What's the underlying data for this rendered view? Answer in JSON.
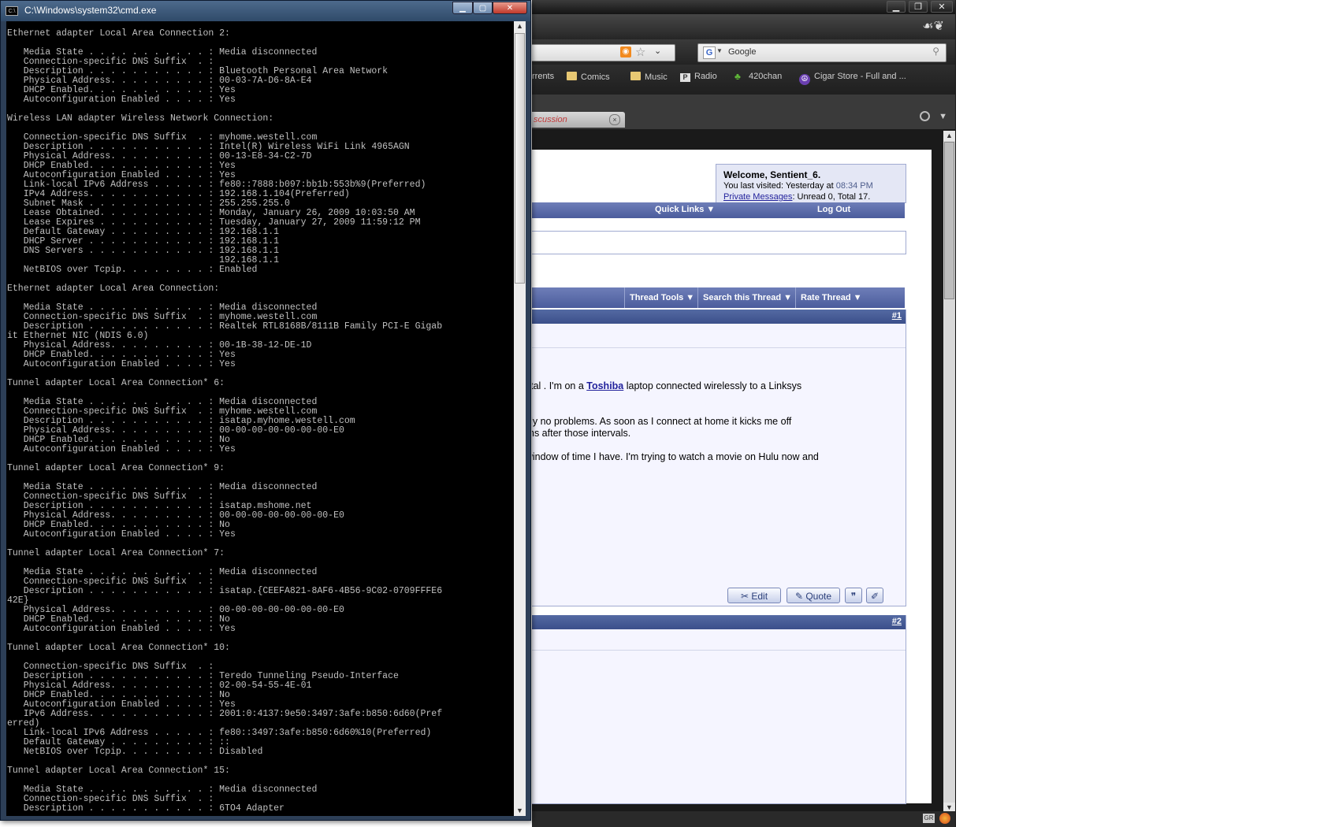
{
  "cmd": {
    "title": "C:\\Windows\\system32\\cmd.exe",
    "icon": "C:\\",
    "controls": {
      "minimize": "▁",
      "maximize": "▢",
      "close": "✕"
    },
    "lines": [
      "Ethernet adapter Local Area Connection 2:",
      "",
      "   Media State . . . . . . . . . . . : Media disconnected",
      "   Connection-specific DNS Suffix  . :",
      "   Description . . . . . . . . . . . : Bluetooth Personal Area Network",
      "   Physical Address. . . . . . . . . : 00-03-7A-D6-8A-E4",
      "   DHCP Enabled. . . . . . . . . . . : Yes",
      "   Autoconfiguration Enabled . . . . : Yes",
      "",
      "Wireless LAN adapter Wireless Network Connection:",
      "",
      "   Connection-specific DNS Suffix  . : myhome.westell.com",
      "   Description . . . . . . . . . . . : Intel(R) Wireless WiFi Link 4965AGN",
      "   Physical Address. . . . . . . . . : 00-13-E8-34-C2-7D",
      "   DHCP Enabled. . . . . . . . . . . : Yes",
      "   Autoconfiguration Enabled . . . . : Yes",
      "   Link-local IPv6 Address . . . . . : fe80::7888:b097:bb1b:553b%9(Preferred)",
      "   IPv4 Address. . . . . . . . . . . : 192.168.1.104(Preferred)",
      "   Subnet Mask . . . . . . . . . . . : 255.255.255.0",
      "   Lease Obtained. . . . . . . . . . : Monday, January 26, 2009 10:03:50 AM",
      "   Lease Expires . . . . . . . . . . : Tuesday, January 27, 2009 11:59:12 PM",
      "   Default Gateway . . . . . . . . . : 192.168.1.1",
      "   DHCP Server . . . . . . . . . . . : 192.168.1.1",
      "   DNS Servers . . . . . . . . . . . : 192.168.1.1",
      "                                       192.168.1.1",
      "   NetBIOS over Tcpip. . . . . . . . : Enabled",
      "",
      "Ethernet adapter Local Area Connection:",
      "",
      "   Media State . . . . . . . . . . . : Media disconnected",
      "   Connection-specific DNS Suffix  . : myhome.westell.com",
      "   Description . . . . . . . . . . . : Realtek RTL8168B/8111B Family PCI-E Gigab",
      "it Ethernet NIC (NDIS 6.0)",
      "   Physical Address. . . . . . . . . : 00-1B-38-12-DE-1D",
      "   DHCP Enabled. . . . . . . . . . . : Yes",
      "   Autoconfiguration Enabled . . . . : Yes",
      "",
      "Tunnel adapter Local Area Connection* 6:",
      "",
      "   Media State . . . . . . . . . . . : Media disconnected",
      "   Connection-specific DNS Suffix  . : myhome.westell.com",
      "   Description . . . . . . . . . . . : isatap.myhome.westell.com",
      "   Physical Address. . . . . . . . . : 00-00-00-00-00-00-00-E0",
      "   DHCP Enabled. . . . . . . . . . . : No",
      "   Autoconfiguration Enabled . . . . : Yes",
      "",
      "Tunnel adapter Local Area Connection* 9:",
      "",
      "   Media State . . . . . . . . . . . : Media disconnected",
      "   Connection-specific DNS Suffix  . :",
      "   Description . . . . . . . . . . . : isatap.mshome.net",
      "   Physical Address. . . . . . . . . : 00-00-00-00-00-00-00-E0",
      "   DHCP Enabled. . . . . . . . . . . : No",
      "   Autoconfiguration Enabled . . . . : Yes",
      "",
      "Tunnel adapter Local Area Connection* 7:",
      "",
      "   Media State . . . . . . . . . . . : Media disconnected",
      "   Connection-specific DNS Suffix  . :",
      "   Description . . . . . . . . . . . : isatap.{CEEFA821-8AF6-4B56-9C02-0709FFFE6",
      "42E}",
      "   Physical Address. . . . . . . . . : 00-00-00-00-00-00-00-E0",
      "   DHCP Enabled. . . . . . . . . . . : No",
      "   Autoconfiguration Enabled . . . . : Yes",
      "",
      "Tunnel adapter Local Area Connection* 10:",
      "",
      "   Connection-specific DNS Suffix  . :",
      "   Description . . . . . . . . . . . : Teredo Tunneling Pseudo-Interface",
      "   Physical Address. . . . . . . . . : 02-00-54-55-4E-01",
      "   DHCP Enabled. . . . . . . . . . . : No",
      "   Autoconfiguration Enabled . . . . : Yes",
      "   IPv6 Address. . . . . . . . . . . : 2001:0:4137:9e50:3497:3afe:b850:6d60(Pref",
      "erred)",
      "   Link-local IPv6 Address . . . . . : fe80::3497:3afe:b850:6d60%10(Preferred)",
      "   Default Gateway . . . . . . . . . : ::",
      "   NetBIOS over Tcpip. . . . . . . . : Disabled",
      "",
      "Tunnel adapter Local Area Connection* 15:",
      "",
      "   Media State . . . . . . . . . . . : Media disconnected",
      "   Connection-specific DNS Suffix  . :",
      "   Description . . . . . . . . . . . : 6TO4 Adapter"
    ],
    "scroll": {
      "up": "▲",
      "down": "▼"
    }
  },
  "browser": {
    "controls": {
      "minimize": "▁",
      "maximize": "❐",
      "close": "✕"
    },
    "logo": "☙❦",
    "search_placeholder": "Google",
    "search_engine_icon": "G",
    "rss_icon": "rss-icon",
    "bookmarks": [
      {
        "label": "rrents",
        "icon": "folder-icon"
      },
      {
        "label": "Comics",
        "icon": "folder-icon"
      },
      {
        "label": "Music",
        "icon": "folder-icon"
      },
      {
        "label": "Radio",
        "icon": "p-icon"
      },
      {
        "label": "420chan",
        "icon": "leaf-icon"
      },
      {
        "label": "Cigar Store - Full and ...",
        "icon": "peace-icon"
      }
    ],
    "tab_label": "scussion",
    "tab_close": "×",
    "status_icon_text": "GR"
  },
  "forum": {
    "welcome_title": "Welcome, Sentient_6.",
    "last_visited_prefix": "You last visited: Yesterday at ",
    "last_visited_time": "08:34 PM",
    "pm_link": "Private Messages",
    "pm_suffix": ": Unread 0, Total 17.",
    "nav_quick_links": "Quick Links",
    "nav_log_out": "Log Out",
    "thread_tools": [
      "Thread Tools",
      "Search this Thread",
      "Rate Thread"
    ],
    "post1_number": "#1",
    "post1_line1_a": "st, total . I'm on a ",
    "post1_toshiba": "Toshiba",
    "post1_line1_b": " laptop connected wirelessly to a Linksys",
    "post1_line2": "olutely no problems. As soon as I connect at home it kicks me off",
    "post1_line3": "treams after those intervals.",
    "post1_line4": "the window of time I have. I'm trying to watch a movie on Hulu now and",
    "buttons": {
      "edit": "Edit",
      "quote": "Quote"
    },
    "post2_number": "#2"
  }
}
